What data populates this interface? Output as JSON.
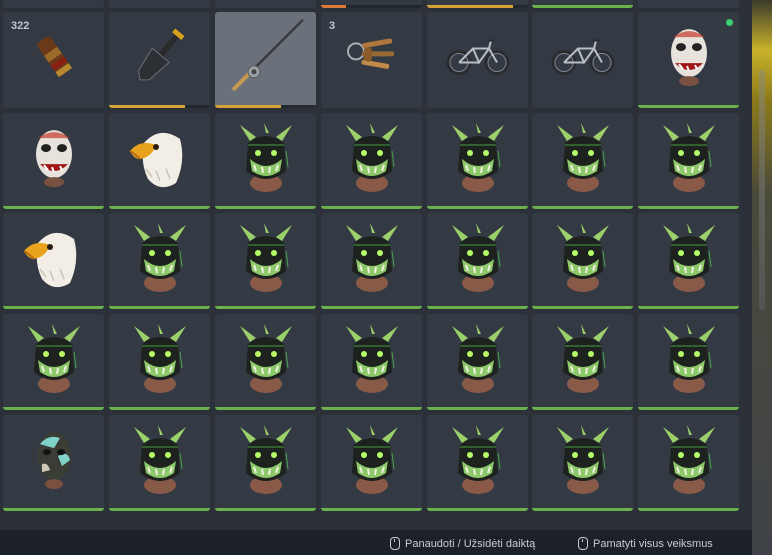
{
  "inventory": {
    "rows": [
      [
        {
          "item": "bullet-cartridge-icon",
          "count": "322",
          "durability": null
        },
        {
          "item": "shovel-icon",
          "count": "",
          "durability": 0.75,
          "bar": "yellow"
        },
        {
          "item": "fishing-rod-icon",
          "count": "",
          "durability": 0.65,
          "bar": "yellow",
          "selected": true
        },
        {
          "item": "keys-icon",
          "count": "3",
          "durability": null
        },
        {
          "item": "bicycle-icon",
          "count": "",
          "durability": null
        },
        {
          "item": "bicycle-icon",
          "count": "",
          "durability": null
        },
        {
          "item": "clown-mask-icon",
          "count": "",
          "durability": 1,
          "bar": "green",
          "equipped": true
        }
      ],
      [
        {
          "item": "clown-mask-icon",
          "count": "",
          "durability": 1,
          "bar": "green"
        },
        {
          "item": "eagle-mask-icon",
          "count": "",
          "durability": 1,
          "bar": "green"
        },
        {
          "item": "demon-mask-icon",
          "count": "",
          "durability": 1,
          "bar": "green"
        },
        {
          "item": "demon-mask-icon",
          "count": "",
          "durability": 1,
          "bar": "green"
        },
        {
          "item": "demon-mask-icon",
          "count": "",
          "durability": 1,
          "bar": "green"
        },
        {
          "item": "demon-mask-icon",
          "count": "",
          "durability": 1,
          "bar": "green"
        },
        {
          "item": "demon-mask-icon",
          "count": "",
          "durability": 1,
          "bar": "green"
        }
      ],
      [
        {
          "item": "eagle-mask-icon",
          "count": "",
          "durability": 1,
          "bar": "green"
        },
        {
          "item": "demon-mask-icon",
          "count": "",
          "durability": 1,
          "bar": "green"
        },
        {
          "item": "demon-mask-icon",
          "count": "",
          "durability": 1,
          "bar": "green"
        },
        {
          "item": "demon-mask-icon",
          "count": "",
          "durability": 1,
          "bar": "green"
        },
        {
          "item": "demon-mask-icon",
          "count": "",
          "durability": 1,
          "bar": "green"
        },
        {
          "item": "demon-mask-icon",
          "count": "",
          "durability": 1,
          "bar": "green"
        },
        {
          "item": "demon-mask-icon",
          "count": "",
          "durability": 1,
          "bar": "green"
        }
      ],
      [
        {
          "item": "demon-mask-icon",
          "count": "",
          "durability": 1,
          "bar": "green"
        },
        {
          "item": "demon-mask-icon",
          "count": "",
          "durability": 1,
          "bar": "green"
        },
        {
          "item": "demon-mask-icon",
          "count": "",
          "durability": 1,
          "bar": "green"
        },
        {
          "item": "demon-mask-icon",
          "count": "",
          "durability": 1,
          "bar": "green"
        },
        {
          "item": "demon-mask-icon",
          "count": "",
          "durability": 1,
          "bar": "green"
        },
        {
          "item": "demon-mask-icon",
          "count": "",
          "durability": 1,
          "bar": "green"
        },
        {
          "item": "demon-mask-icon",
          "count": "",
          "durability": 1,
          "bar": "green"
        }
      ],
      [
        {
          "item": "camo-mask-icon",
          "count": "",
          "durability": 1,
          "bar": "green"
        },
        {
          "item": "demon-mask-icon",
          "count": "",
          "durability": 1,
          "bar": "green"
        },
        {
          "item": "demon-mask-icon",
          "count": "",
          "durability": 1,
          "bar": "green"
        },
        {
          "item": "demon-mask-icon",
          "count": "",
          "durability": 1,
          "bar": "green"
        },
        {
          "item": "demon-mask-icon",
          "count": "",
          "durability": 1,
          "bar": "green"
        },
        {
          "item": "demon-mask-icon",
          "count": "",
          "durability": 1,
          "bar": "green"
        },
        {
          "item": "demon-mask-icon",
          "count": "",
          "durability": 1,
          "bar": "green"
        }
      ]
    ],
    "partial_top_bars": [
      {
        "bar": "none",
        "durability": 0
      },
      {
        "bar": "none",
        "durability": 0
      },
      {
        "bar": "none",
        "durability": 0
      },
      {
        "bar": "orange",
        "durability": 0.25
      },
      {
        "bar": "yellow",
        "durability": 0.85
      },
      {
        "bar": "green",
        "durability": 1
      },
      {
        "bar": "none",
        "durability": 0
      }
    ]
  },
  "footer": {
    "use_hint": "Panaudoti / Užsidėti daiktą",
    "actions_hint": "Pamatyti visus veiksmus"
  },
  "colors": {
    "slot_bg": "#343a44",
    "selected_bg": "#6b717b",
    "bar_green": "#6ab04c",
    "bar_yellow": "#d6a33a",
    "bar_orange": "#d97b3a",
    "equipped_dot": "#3bd16f"
  }
}
